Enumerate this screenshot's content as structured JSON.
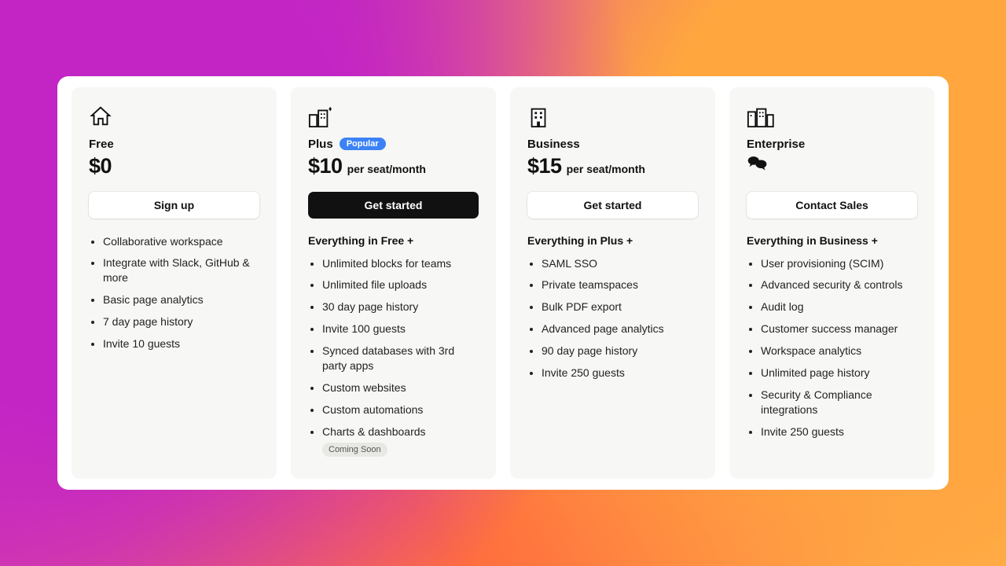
{
  "plans": [
    {
      "name": "Free",
      "price": "$0",
      "per": "",
      "cta": "Sign up",
      "cta_style": "light",
      "heading": "",
      "features": [
        "Collaborative workspace",
        "Integrate with Slack, GitHub & more",
        "Basic page analytics",
        "7 day page history",
        "Invite 10 guests"
      ]
    },
    {
      "name": "Plus",
      "badge": "Popular",
      "price": "$10",
      "per": "per seat/month",
      "cta": "Get started",
      "cta_style": "dark",
      "heading": "Everything in Free +",
      "features": [
        "Unlimited blocks for teams",
        "Unlimited file uploads",
        "30 day page history",
        "Invite 100 guests",
        "Synced databases with 3rd party apps",
        "Custom websites",
        "Custom automations",
        "Charts & dashboards"
      ],
      "feature_pill": "Coming Soon",
      "feature_pill_index": 7
    },
    {
      "name": "Business",
      "price": "$15",
      "per": "per seat/month",
      "cta": "Get started",
      "cta_style": "light",
      "heading": "Everything in Plus +",
      "features": [
        "SAML SSO",
        "Private teamspaces",
        "Bulk PDF export",
        "Advanced page analytics",
        "90 day page history",
        "Invite 250 guests"
      ]
    },
    {
      "name": "Enterprise",
      "price": "",
      "per": "",
      "contact_icon": true,
      "cta": "Contact Sales",
      "cta_style": "light",
      "heading": "Everything in Business +",
      "features": [
        "User provisioning (SCIM)",
        "Advanced security & controls",
        "Audit log",
        "Customer success manager",
        "Workspace analytics",
        "Unlimited page history",
        "Security & Compliance integrations",
        "Invite 250 guests"
      ]
    }
  ]
}
